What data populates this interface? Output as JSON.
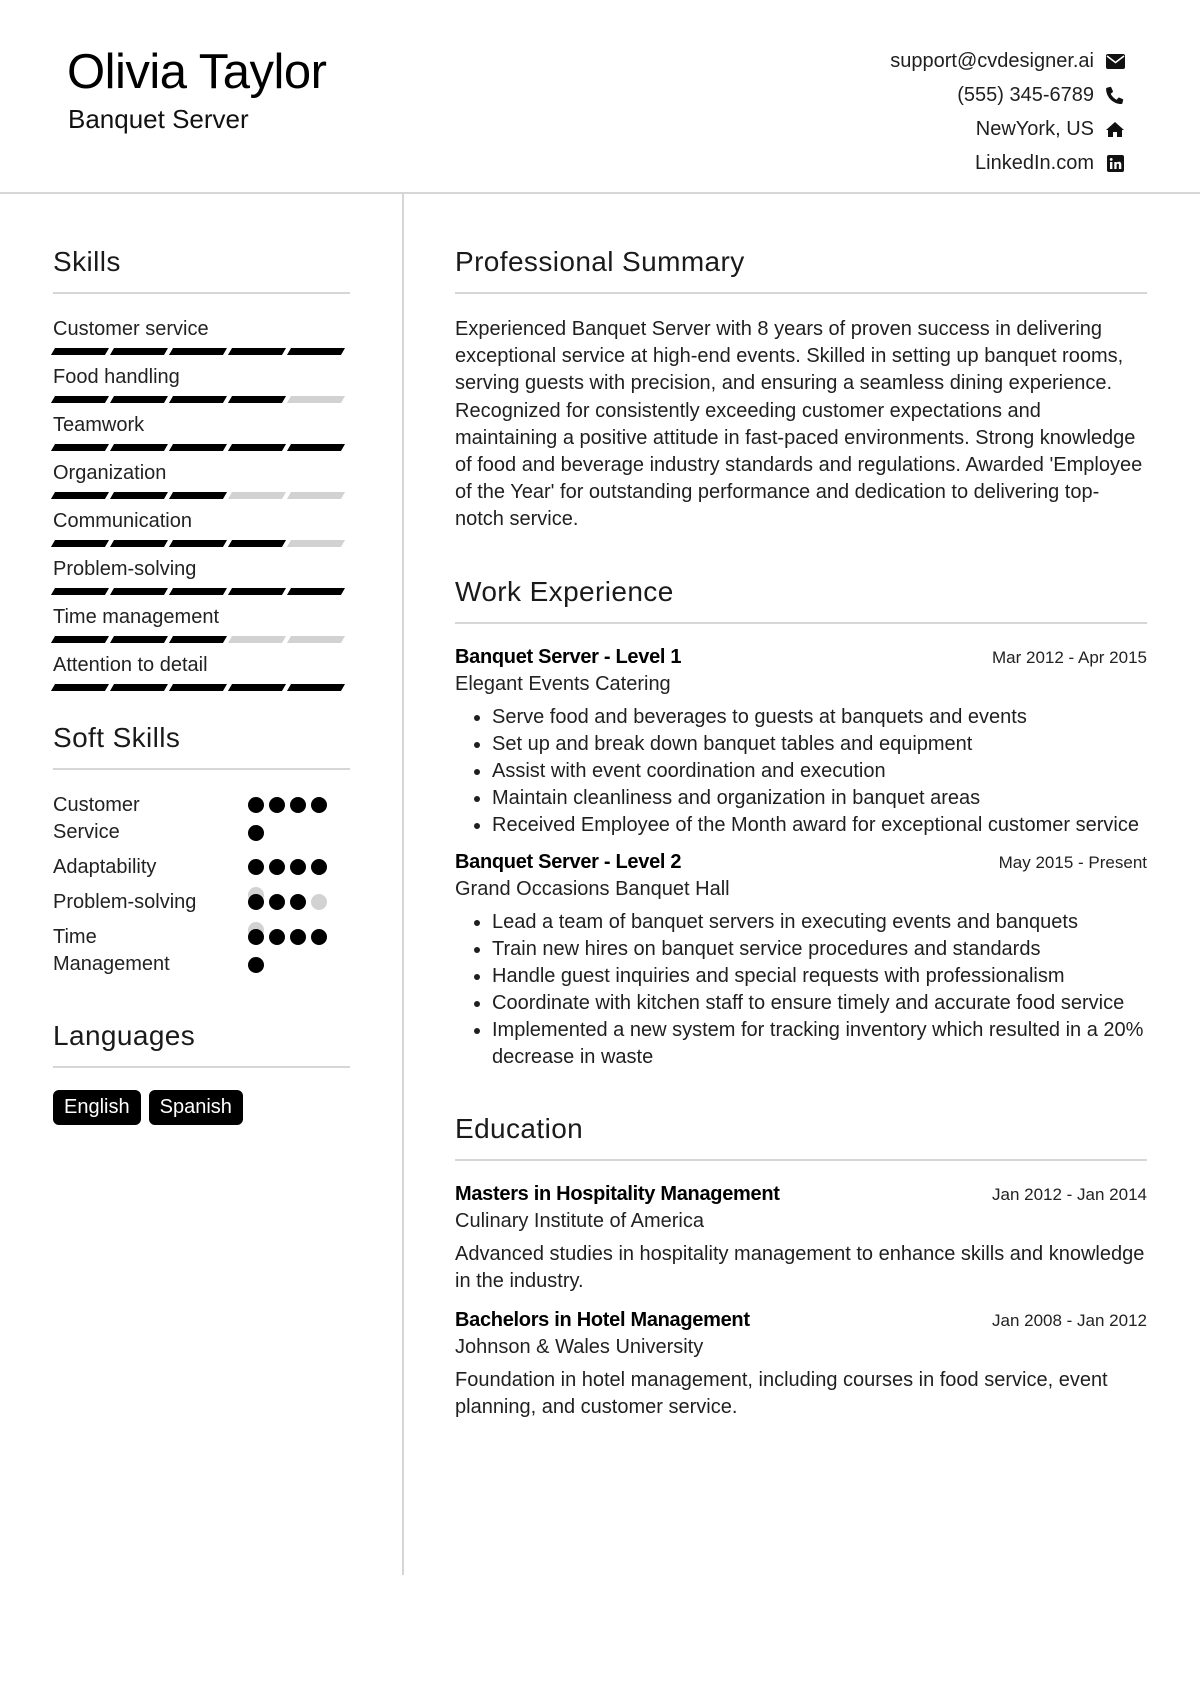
{
  "header": {
    "name": "Olivia Taylor",
    "role": "Banquet Server",
    "contacts": [
      {
        "text": "support@cvdesigner.ai",
        "icon": "envelope-icon"
      },
      {
        "text": "(555) 345-6789",
        "icon": "phone-icon"
      },
      {
        "text": "NewYork, US",
        "icon": "home-icon"
      },
      {
        "text": "LinkedIn.com",
        "icon": "linkedin-icon"
      }
    ]
  },
  "skills": {
    "title": "Skills",
    "max": 5,
    "items": [
      {
        "label": "Customer service",
        "level": 5
      },
      {
        "label": "Food handling",
        "level": 4
      },
      {
        "label": "Teamwork",
        "level": 5
      },
      {
        "label": "Organization",
        "level": 3
      },
      {
        "label": "Communication",
        "level": 4
      },
      {
        "label": "Problem-solving",
        "level": 5
      },
      {
        "label": "Time management",
        "level": 3
      },
      {
        "label": "Attention to detail",
        "level": 5
      }
    ]
  },
  "soft_skills": {
    "title": "Soft Skills",
    "max": 5,
    "items": [
      {
        "label": "Customer Service",
        "level": 5
      },
      {
        "label": "Adaptability",
        "level": 4
      },
      {
        "label": "Problem-solving",
        "level": 3
      },
      {
        "label": "Time Management",
        "level": 5
      }
    ]
  },
  "languages": {
    "title": "Languages",
    "items": [
      "English",
      "Spanish"
    ]
  },
  "summary": {
    "title": "Professional Summary",
    "text": "Experienced Banquet Server with 8 years of proven success in delivering exceptional service at high-end events. Skilled in setting up banquet rooms, serving guests with precision, and ensuring a seamless dining experience. Recognized for consistently exceeding customer expectations and maintaining a positive attitude in fast-paced environments. Strong knowledge of food and beverage industry standards and regulations. Awarded 'Employee of the Year' for outstanding performance and dedication to delivering top-notch service."
  },
  "experience": {
    "title": "Work Experience",
    "jobs": [
      {
        "title": "Banquet Server - Level 1",
        "date": "Mar 2012 - Apr 2015",
        "org": "Elegant Events Catering",
        "bullets": [
          "Serve food and beverages to guests at banquets and events",
          "Set up and break down banquet tables and equipment",
          "Assist with event coordination and execution",
          "Maintain cleanliness and organization in banquet areas",
          "Received Employee of the Month award for exceptional customer service"
        ]
      },
      {
        "title": "Banquet Server - Level 2",
        "date": "May 2015 - Present",
        "org": "Grand Occasions Banquet Hall",
        "bullets": [
          "Lead a team of banquet servers in executing events and banquets",
          "Train new hires on banquet service procedures and standards",
          "Handle guest inquiries and special requests with professionalism",
          "Coordinate with kitchen staff to ensure timely and accurate food service",
          "Implemented a new system for tracking inventory which resulted in a 20% decrease in waste"
        ]
      }
    ]
  },
  "education": {
    "title": "Education",
    "items": [
      {
        "degree": "Masters in Hospitality Management",
        "date": "Jan 2012 - Jan 2014",
        "school": "Culinary Institute of America",
        "desc": "Advanced studies in hospitality management to enhance skills and knowledge in the industry."
      },
      {
        "degree": "Bachelors in Hotel Management",
        "date": "Jan 2008 - Jan 2012",
        "school": "Johnson & Wales University",
        "desc": "Foundation in hotel management, including courses in food service, event planning, and customer service."
      }
    ]
  }
}
